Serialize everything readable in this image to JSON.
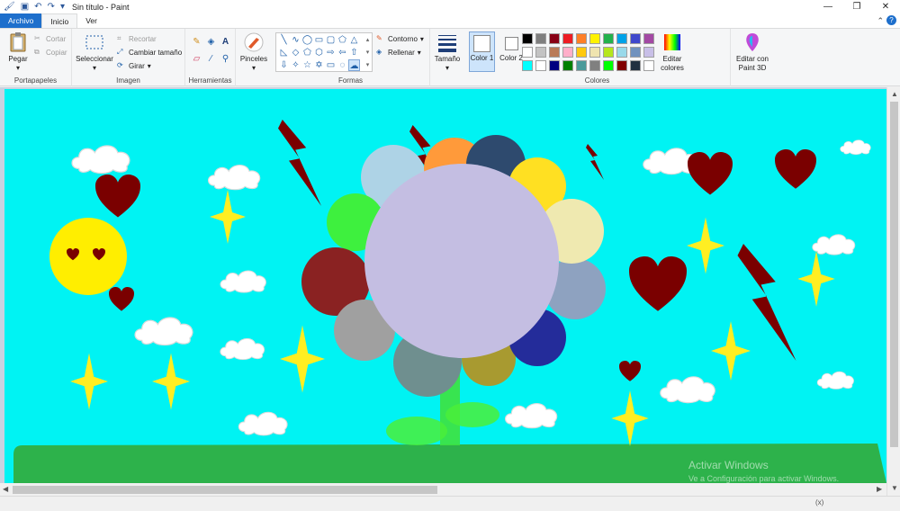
{
  "window": {
    "title": "Sin título - Paint"
  },
  "tabs": [
    "Archivo",
    "Inicio",
    "Ver"
  ],
  "ribbon": {
    "portapapeles": {
      "label": "Portapapeles",
      "paste": "Pegar",
      "cut": "Cortar",
      "copy": "Copiar"
    },
    "imagen": {
      "label": "Imagen",
      "select": "Seleccionar",
      "crop": "Recortar",
      "resize": "Cambiar tamaño",
      "rotate": "Girar"
    },
    "herramientas": {
      "label": "Herramientas"
    },
    "pinceles": {
      "label": "Pinceles"
    },
    "formas": {
      "label": "Formas",
      "outline": "Contorno",
      "fill": "Rellenar"
    },
    "tamano": {
      "label": "Tamaño"
    },
    "colores": {
      "label": "Colores",
      "color1": "Color 1",
      "color2": "Color 2",
      "edit": "Editar colores",
      "paint3d": "Editar con Paint 3D"
    }
  },
  "palette": [
    "#000000",
    "#7f7f7f",
    "#880015",
    "#ed1c24",
    "#ff7f27",
    "#fff200",
    "#22b14c",
    "#00a2e8",
    "#3f48cc",
    "#a349a4",
    "#ffffff",
    "#c3c3c3",
    "#b97a57",
    "#ffaec9",
    "#ffc90e",
    "#efe4b0",
    "#b5e61d",
    "#99d9ea",
    "#7092be",
    "#c8bfe7",
    "#00ffff",
    "#ffffff",
    "#000080",
    "#008000",
    "#4a9a9a",
    "#808080",
    "#00ff00",
    "#800000",
    "#203040",
    "#ffffff"
  ],
  "colors": {
    "color1": "#ffffff",
    "color2": "#ffffff",
    "sky": "#00f3f3",
    "grass": "#2db24b",
    "center": "#c4bee2",
    "heart": "#7a0000",
    "star": "#ffee22"
  },
  "watermark": {
    "line1": "Activar Windows",
    "line2": "Ve a Configuración para activar Windows."
  },
  "status": {
    "coords": "(x)"
  }
}
